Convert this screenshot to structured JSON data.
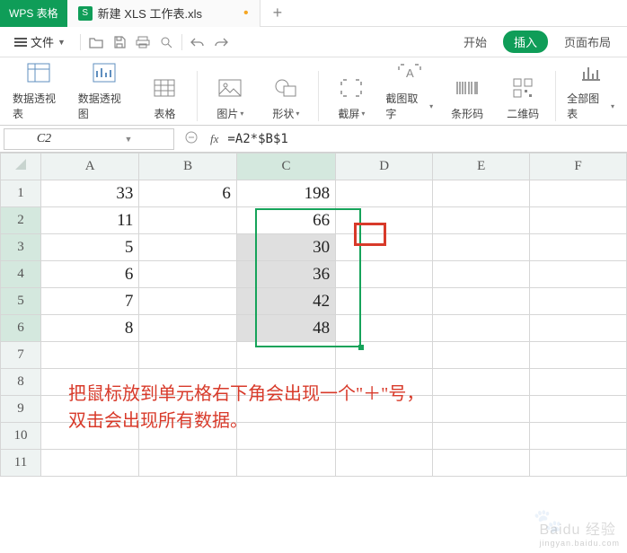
{
  "app": {
    "name": "WPS 表格"
  },
  "document": {
    "icon_letter": "S",
    "title": "新建 XLS 工作表.xls",
    "modified_dot": "•"
  },
  "new_tab_plus": "+",
  "file_menu": {
    "label": "文件"
  },
  "ribbon_tabs": {
    "start": "开始",
    "insert": "插入",
    "layout": "页面布局"
  },
  "ribbon_groups": {
    "pivot_table": "数据透视表",
    "pivot_chart": "数据透视图",
    "table": "表格",
    "picture": "图片",
    "shape": "形状",
    "screenshot": "截屏",
    "screenshot_text": "截图取字",
    "barcode": "条形码",
    "qrcode": "二维码",
    "all_charts": "全部图表"
  },
  "name_box": {
    "value": "C2"
  },
  "formula": {
    "fx": "fx",
    "value": "=A2*$B$1"
  },
  "columns": [
    "A",
    "B",
    "C",
    "D",
    "E",
    "F"
  ],
  "rows": [
    "1",
    "2",
    "3",
    "4",
    "5",
    "6",
    "7",
    "8",
    "9",
    "10",
    "11"
  ],
  "cells": {
    "A1": "33",
    "B1": "6",
    "C1": "198",
    "A2": "11",
    "C2": "66",
    "A3": "5",
    "C3": "30",
    "A4": "6",
    "C4": "36",
    "A5": "7",
    "C5": "42",
    "A6": "8",
    "C6": "48"
  },
  "annotation": {
    "line1": "把鼠标放到单元格右下角会出现一个\"＋\"号，",
    "line2": "双击会出现所有数据。"
  },
  "watermark": {
    "main": "Baidu 经验",
    "sub": "jingyan.baidu.com"
  }
}
